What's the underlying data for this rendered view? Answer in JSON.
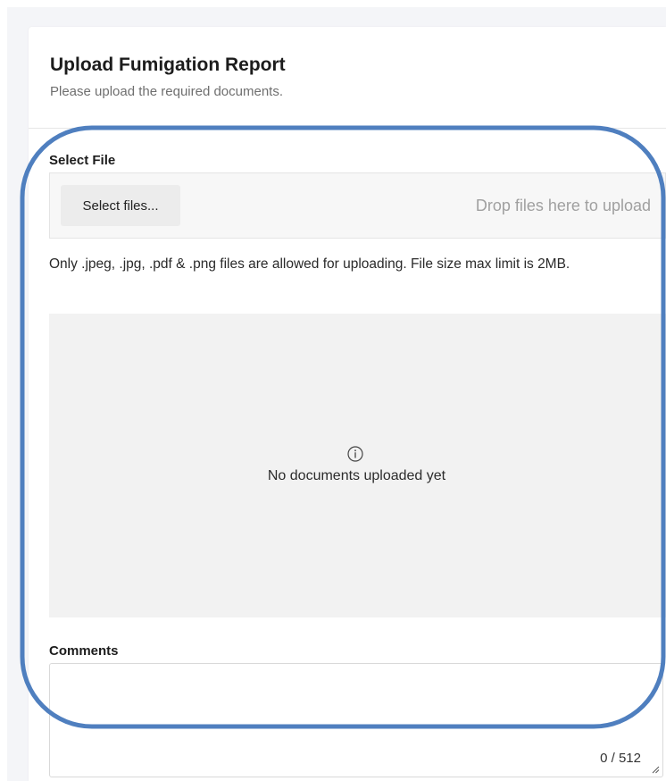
{
  "header": {
    "title": "Upload Fumigation Report",
    "subtitle": "Please upload the required documents."
  },
  "upload": {
    "label": "Select File",
    "button_label": "Select files...",
    "drop_hint": "Drop files here to upload",
    "note": "Only .jpeg, .jpg, .pdf & .png files are allowed for uploading. File size max limit is 2MB."
  },
  "documents": {
    "empty_message": "No documents uploaded yet",
    "icon": "info-icon"
  },
  "comments": {
    "label": "Comments",
    "value": "",
    "char_count": "0 / 512"
  },
  "colors": {
    "page_background": "#f4f5f8",
    "panel_background": "#f2f2f2",
    "annotation_stroke": "#4f7fbf"
  }
}
